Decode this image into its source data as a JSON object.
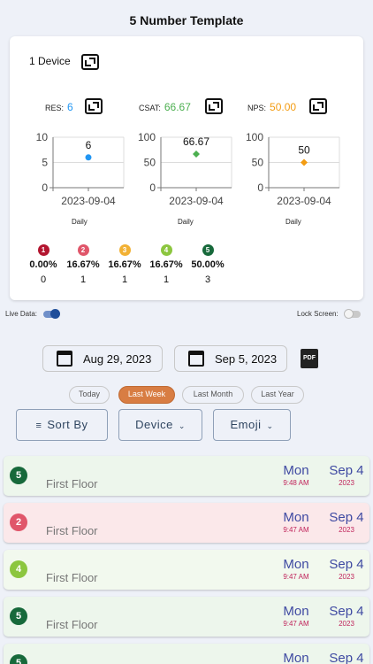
{
  "header": {
    "title": "5 Number Template"
  },
  "card": {
    "device_label": "1 Device",
    "metrics": [
      {
        "label": "RES:",
        "value": "6",
        "color": "#2196f3"
      },
      {
        "label": "CSAT:",
        "value": "66.67",
        "color": "#4caf50"
      },
      {
        "label": "NPS:",
        "value": "50.00",
        "color": "#f39c12"
      }
    ],
    "period_labels": [
      "Daily",
      "Daily",
      "Daily"
    ],
    "emojis": [
      {
        "num": "1",
        "pct": "0.00%",
        "count": "0",
        "color": "#b3152f"
      },
      {
        "num": "2",
        "pct": "16.67%",
        "count": "1",
        "color": "#e0566a"
      },
      {
        "num": "3",
        "pct": "16.67%",
        "count": "1",
        "color": "#f2b134"
      },
      {
        "num": "4",
        "pct": "16.67%",
        "count": "1",
        "color": "#8cc63f"
      },
      {
        "num": "5",
        "pct": "50.00%",
        "count": "3",
        "color": "#17693b"
      }
    ]
  },
  "chart_data": [
    {
      "type": "scatter",
      "x": [
        "2023-09-04"
      ],
      "values": [
        6
      ],
      "data_label": "6",
      "yticks": [
        "10",
        "5",
        "0"
      ],
      "ylim": [
        0,
        10
      ],
      "color": "#2196f3",
      "marker": "circle"
    },
    {
      "type": "scatter",
      "x": [
        "2023-09-04"
      ],
      "values": [
        66.67
      ],
      "data_label": "66.67",
      "yticks": [
        "100",
        "50",
        "0"
      ],
      "ylim": [
        0,
        100
      ],
      "color": "#4caf50",
      "marker": "diamond"
    },
    {
      "type": "scatter",
      "x": [
        "2023-09-04"
      ],
      "values": [
        50
      ],
      "data_label": "50",
      "yticks": [
        "100",
        "50",
        "0"
      ],
      "ylim": [
        0,
        100
      ],
      "color": "#f39c12",
      "marker": "diamond"
    }
  ],
  "toggles": {
    "live_label": "Live Data:",
    "live_on": true,
    "lock_label": "Lock Screen:",
    "lock_on": false
  },
  "dates": {
    "start": "Aug 29, 2023",
    "end": "Sep 5, 2023",
    "pdf_label": "PDF"
  },
  "chips": [
    "Today",
    "Last Week",
    "Last Month",
    "Last Year"
  ],
  "active_chip": "Last Week",
  "filters": {
    "sort": "Sort By",
    "device": "Device",
    "emoji": "Emoji"
  },
  "responses": [
    {
      "num": "5",
      "color": "#17693b",
      "bg": "#edf6ec",
      "location": "First Floor",
      "day": "Mon",
      "time": "9:48 AM",
      "date": "Sep 4",
      "year": "2023"
    },
    {
      "num": "2",
      "color": "#e0566a",
      "bg": "#fbe8ea",
      "location": "First Floor",
      "day": "Mon",
      "time": "9:47 AM",
      "date": "Sep 4",
      "year": "2023"
    },
    {
      "num": "4",
      "color": "#8cc63f",
      "bg": "#f2f9ee",
      "location": "First Floor",
      "day": "Mon",
      "time": "9:47 AM",
      "date": "Sep 4",
      "year": "2023"
    },
    {
      "num": "5",
      "color": "#17693b",
      "bg": "#edf6ec",
      "location": "First Floor",
      "day": "Mon",
      "time": "9:47 AM",
      "date": "Sep 4",
      "year": "2023"
    },
    {
      "num": "5",
      "color": "#17693b",
      "bg": "#edf6ec",
      "location": "",
      "day": "Mon",
      "time": "",
      "date": "Sep 4",
      "year": ""
    }
  ]
}
